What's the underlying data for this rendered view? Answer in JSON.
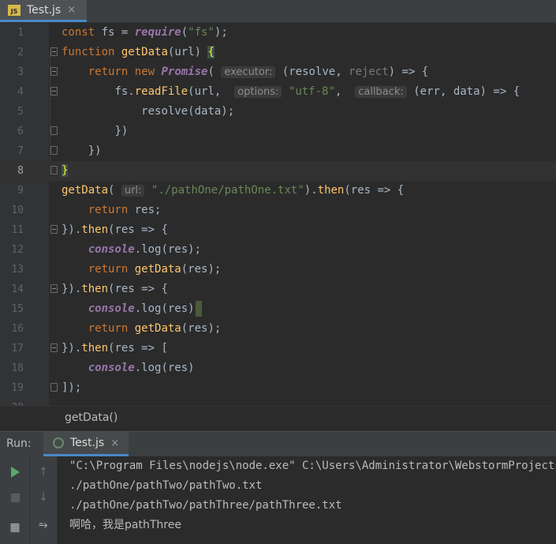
{
  "editor_tab": {
    "icon": "JS",
    "label": "Test.js",
    "close": "×"
  },
  "code": {
    "lines": [
      {
        "n": "1"
      },
      {
        "n": "2"
      },
      {
        "n": "3"
      },
      {
        "n": "4"
      },
      {
        "n": "5"
      },
      {
        "n": "6"
      },
      {
        "n": "7"
      },
      {
        "n": "8"
      },
      {
        "n": "9"
      },
      {
        "n": "10"
      },
      {
        "n": "11"
      },
      {
        "n": "12"
      },
      {
        "n": "13"
      },
      {
        "n": "14"
      },
      {
        "n": "15"
      },
      {
        "n": "16"
      },
      {
        "n": "17"
      },
      {
        "n": "18"
      },
      {
        "n": "19"
      },
      {
        "n": "20"
      }
    ],
    "t": {
      "const": "const",
      "fs": " fs = ",
      "require": "require",
      "lp": "(",
      "fs_str": "\"fs\"",
      "rp_semi": ");",
      "function": "function",
      "getData": "getData",
      "url_param": "(url) ",
      "lbrace": "{",
      "return": "return",
      "new": "new",
      "Promise": "Promise",
      "executor": "executor:",
      "resolve_reject_a": " (resolve, ",
      "reject": "reject",
      "arrow_brace": ") => {",
      "fs_dot": "fs.",
      "readFile": "readFile",
      "url_comma": "(url,  ",
      "options": "options:",
      "utf8": "\"utf-8\"",
      "comma": ",  ",
      "callback": "callback:",
      "err_data": " (err, data) => {",
      "resolve_data": "resolve(data);",
      "close_paren": "})",
      "rbrace": "}",
      "getData_call": "getData(",
      "url_hint": "url:",
      "path_one": "\"./pathOne/pathOne.txt\"",
      "then_a": ").",
      "then": "then",
      "res_arrow": "(res => {",
      "return_res": " res;",
      "close_then": "}).",
      "console": "console",
      "dot_log": ".log(res);",
      "getData_res": "(res);",
      "dot_log_nosemi": ".log(res)",
      "res_arrow_bracket": "(res => [",
      "close_final": "]);"
    }
  },
  "breadcrumb": {
    "label": "getData()"
  },
  "run": {
    "label": "Run:",
    "tab_label": "Test.js",
    "tab_close": "×",
    "output": [
      "\"C:\\Program Files\\nodejs\\node.exe\" C:\\Users\\Administrator\\WebstormProjects",
      "./pathOne/pathTwo/pathTwo.txt",
      "./pathOne/pathTwo/pathThree/pathThree.txt",
      "啊哈，我是pathThree"
    ],
    "toolbar": {
      "rerun": "play-icon",
      "stop": "stop-icon",
      "up": "↑",
      "down": "↓",
      "wrap": "⥱",
      "layout": "▦"
    }
  },
  "colors": {
    "keyword": "#cc7832",
    "function": "#ffc66d",
    "string": "#6a8759",
    "identifier": "#9876aa",
    "text": "#a9b7c6",
    "background": "#2b2b2b"
  }
}
